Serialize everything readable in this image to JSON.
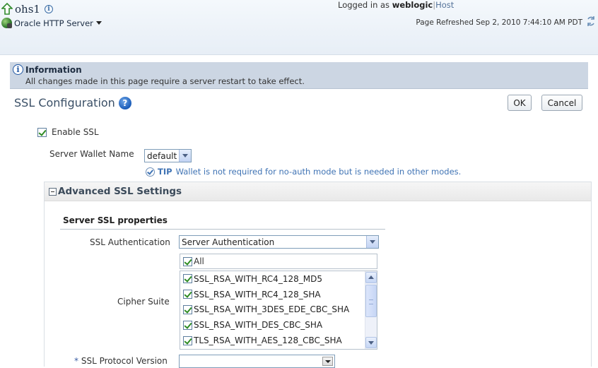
{
  "header": {
    "target_name": "ohs1",
    "target_menu_label": "Oracle HTTP Server",
    "logged_in_prefix": "Logged in as",
    "logged_in_user": "weblogic",
    "host_link": "Host",
    "refreshed": "Page Refreshed Sep 2, 2010 7:44:10 AM PDT"
  },
  "info_banner": {
    "title": "Information",
    "text": "All changes made in this page require a server restart to take effect."
  },
  "page": {
    "title": "SSL Configuration",
    "ok_label": "OK",
    "cancel_label": "Cancel"
  },
  "form": {
    "enable_ssl_label": "Enable SSL",
    "enable_ssl_checked": true,
    "wallet_label": "Server Wallet Name",
    "wallet_value": "default",
    "tip_keyword": "TIP",
    "tip_text": "Wallet is not required for no-auth mode but is needed in other modes."
  },
  "advanced": {
    "header": "Advanced SSL Settings",
    "subsection_title": "Server SSL properties",
    "auth_label": "SSL Authentication",
    "auth_value": "Server Authentication",
    "cipher_label": "Cipher Suite",
    "cipher_all_label": "All",
    "ciphers": [
      "SSL_RSA_WITH_RC4_128_MD5",
      "SSL_RSA_WITH_RC4_128_SHA",
      "SSL_RSA_WITH_3DES_EDE_CBC_SHA",
      "SSL_RSA_WITH_DES_CBC_SHA",
      "TLS_RSA_WITH_AES_128_CBC_SHA"
    ],
    "protocol_required_mark": "*",
    "protocol_label": "SSL Protocol Version",
    "protocol_value": ""
  },
  "colors": {
    "header_bg": "#e7eef6",
    "banner_bg": "#ccd6e3",
    "tip_text": "#3f73b4",
    "check_green": "#2e8b23"
  },
  "icons": {
    "target": "up-arrow-icon",
    "info": "info-icon",
    "help": "help-icon",
    "refresh": "refresh-icon",
    "tip": "checkmark-circle-icon",
    "target_type": "globe-server-icon"
  }
}
